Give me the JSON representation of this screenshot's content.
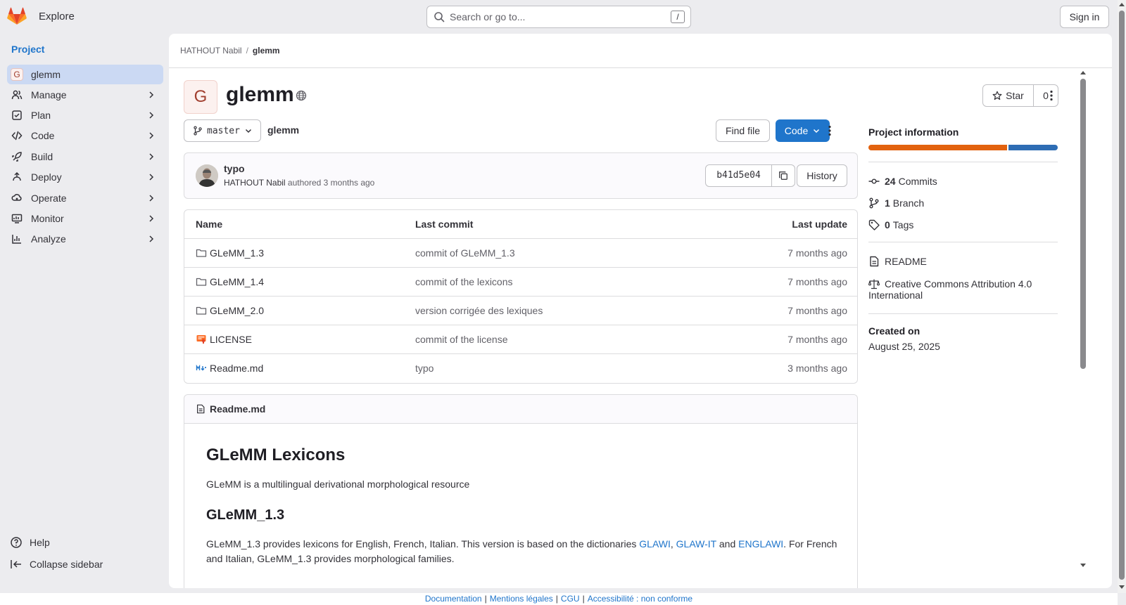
{
  "topbar": {
    "explore_label": "Explore",
    "search_placeholder": "Search or go to...",
    "search_shortcut": "/",
    "signin_label": "Sign in"
  },
  "sidebar": {
    "title": "Project",
    "project_initial": "G",
    "items": [
      {
        "label": "glemm",
        "icon": "project-avatar"
      },
      {
        "label": "Manage",
        "icon": "manage-icon"
      },
      {
        "label": "Plan",
        "icon": "plan-icon"
      },
      {
        "label": "Code",
        "icon": "code-icon"
      },
      {
        "label": "Build",
        "icon": "rocket-icon"
      },
      {
        "label": "Deploy",
        "icon": "deploy-icon"
      },
      {
        "label": "Operate",
        "icon": "operate-icon"
      },
      {
        "label": "Monitor",
        "icon": "monitor-icon"
      },
      {
        "label": "Analyze",
        "icon": "chart-icon"
      }
    ],
    "help_label": "Help",
    "collapse_label": "Collapse sidebar"
  },
  "breadcrumb": {
    "owner": "HATHOUT Nabil",
    "separator": "/",
    "project": "glemm"
  },
  "project": {
    "initial": "G",
    "name": "glemm",
    "star_label": "Star",
    "star_count": "0"
  },
  "repo": {
    "branch": "master",
    "path": "glemm",
    "find_file_label": "Find file",
    "code_label": "Code"
  },
  "commit": {
    "message": "typo",
    "author": "HATHOUT Nabil",
    "authored_text": "authored",
    "time": "3 months ago",
    "sha": "b41d5e04",
    "history_label": "History"
  },
  "files": {
    "headers": {
      "name": "Name",
      "last_commit": "Last commit",
      "last_update": "Last update"
    },
    "rows": [
      {
        "name": "GLeMM_1.3",
        "type": "folder",
        "commit": "commit of GLeMM_1.3",
        "update": "7 months ago"
      },
      {
        "name": "GLeMM_1.4",
        "type": "folder",
        "commit": "commit of the lexicons",
        "update": "7 months ago"
      },
      {
        "name": "GLeMM_2.0",
        "type": "folder",
        "commit": "version corrigée des lexiques",
        "update": "7 months ago"
      },
      {
        "name": "LICENSE",
        "type": "license",
        "commit": "commit of the license",
        "update": "7 months ago"
      },
      {
        "name": "Readme.md",
        "type": "markdown",
        "commit": "typo",
        "update": "3 months ago"
      }
    ]
  },
  "readme": {
    "filename": "Readme.md",
    "h1": "GLeMM Lexicons",
    "intro": "GLeMM is a multilingual derivational morphological resource",
    "h2": "GLeMM_1.3",
    "para_start": "GLeMM_1.3 provides lexicons for English, French, Italian. This version is based on the dictionaries ",
    "link1": "GLAWI",
    "comma": ", ",
    "link2": "GLAW-IT",
    "and": " and ",
    "link3": "ENGLAWI",
    "para_end": ". For French and Italian, GLeMM_1.3 provides morphological families."
  },
  "info": {
    "title": "Project information",
    "lang_colors": [
      "#e24329",
      "#1f75cb"
    ],
    "commits_count": "24",
    "commits_label": "Commits",
    "branch_count": "1",
    "branch_label": "Branch",
    "tags_count": "0",
    "tags_label": "Tags",
    "readme_label": "README",
    "license_label": "Creative Commons Attribution 4.0 International",
    "created_label": "Created on",
    "created_value": "August 25, 2025"
  },
  "footer": {
    "links": [
      "Documentation",
      "Mentions légales",
      "CGU",
      "Accessibilité : non conforme"
    ],
    "separator": "|"
  },
  "colors": {
    "accent": "#1f75cb",
    "sidebar_active": "#cbd9f3"
  }
}
